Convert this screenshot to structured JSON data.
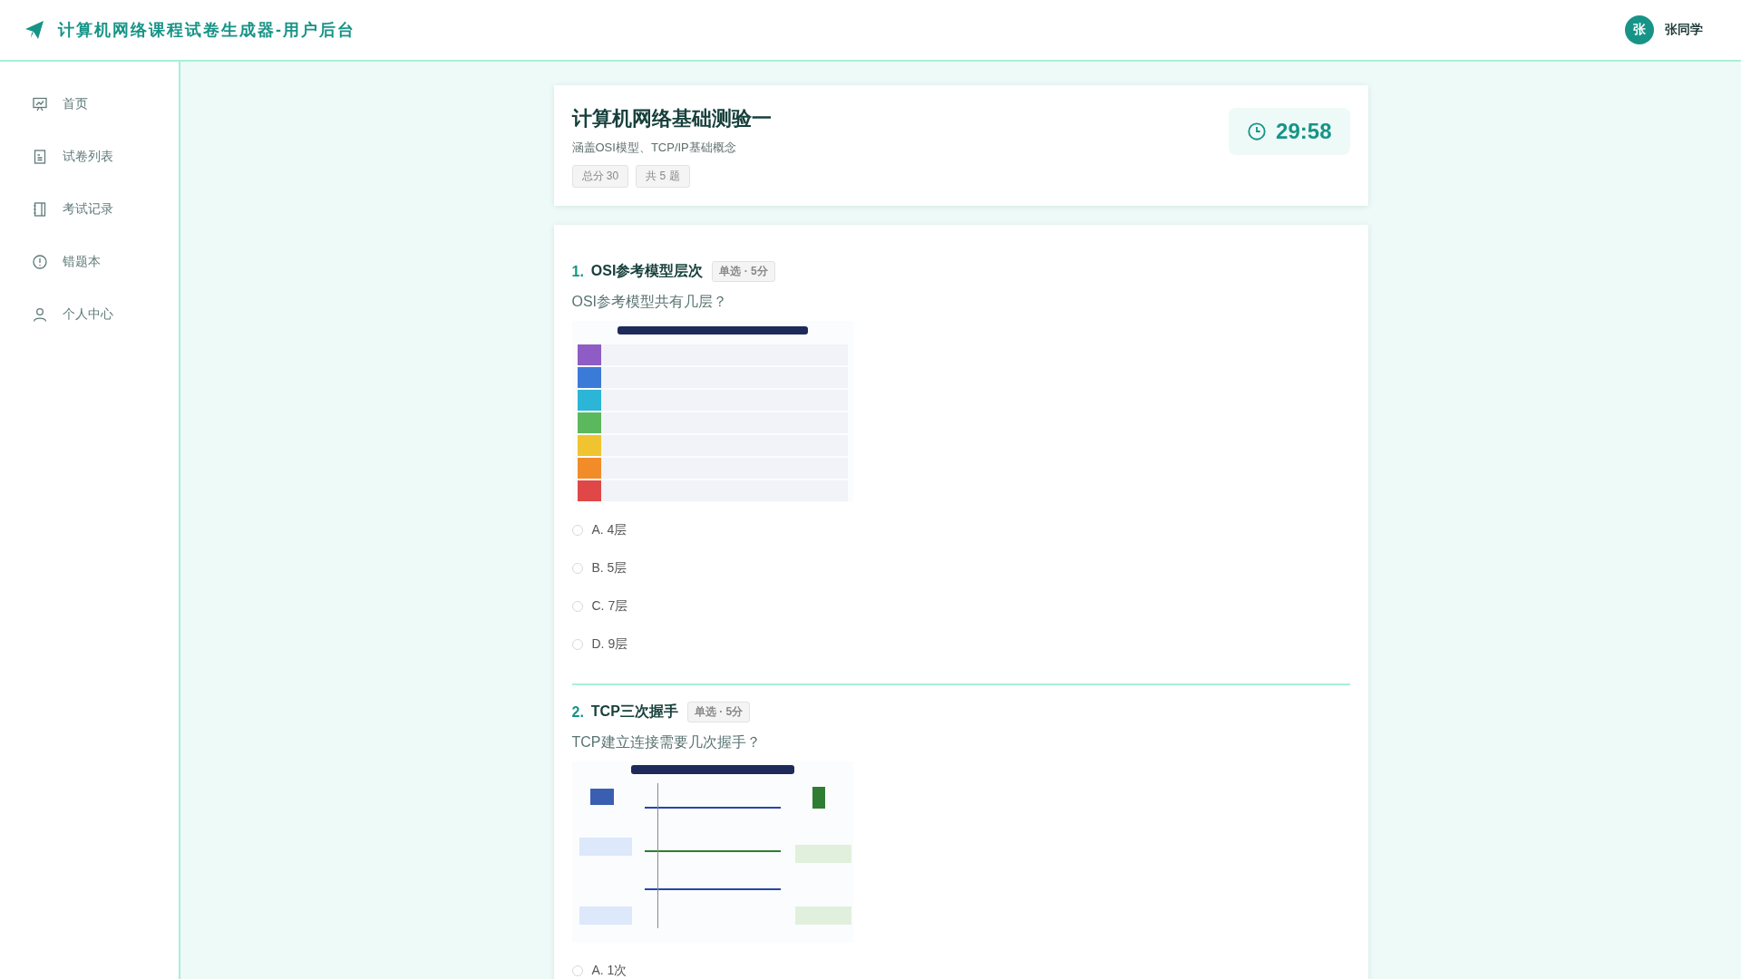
{
  "header": {
    "title": "计算机网络课程试卷生成器-用户后台",
    "user": {
      "avatar": "张",
      "name": "张同学"
    }
  },
  "sidebar": {
    "items": [
      {
        "label": "首页",
        "selected": false
      },
      {
        "label": "试卷列表",
        "selected": false
      },
      {
        "label": "考试记录",
        "selected": false
      },
      {
        "label": "错题本",
        "selected": false
      },
      {
        "label": "个人中心",
        "selected": false
      }
    ]
  },
  "exam": {
    "title": "计算机网络基础测验一",
    "subtitle": "涵盖OSI模型、TCP/IP基础概念",
    "tags": [
      "总分 30",
      "共 5 题"
    ],
    "timer": "29:58"
  },
  "questions": [
    {
      "number": "1.",
      "title": "OSI参考模型层次",
      "tag": "单选 · 5分",
      "text": "OSI参考模型共有几层？",
      "image": {
        "kind": "picture"
      },
      "options": [
        {
          "label": "A. 4层",
          "selected": false
        },
        {
          "label": "B. 5层",
          "selected": false
        },
        {
          "label": "C. 7层",
          "selected": false
        },
        {
          "label": "D. 9层",
          "selected": false
        }
      ]
    },
    {
      "number": "2.",
      "title": "TCP三次握手",
      "tag": "单选 · 5分",
      "text": "TCP建立连接需要几次握手？",
      "image": {
        "kind": "picture"
      },
      "options": [
        {
          "label": "A. 1次",
          "selected": false
        }
      ]
    }
  ]
}
